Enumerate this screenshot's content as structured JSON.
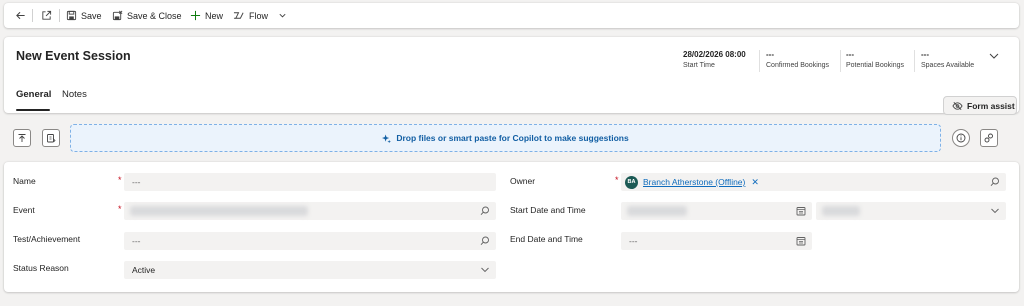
{
  "toolbar": {
    "save_label": "Save",
    "save_close_label": "Save & Close",
    "new_label": "New",
    "flow_label": "Flow"
  },
  "header": {
    "title": "New Event Session",
    "kpis": [
      {
        "value": "28/02/2026 08:00",
        "label": "Start Time"
      },
      {
        "value": "---",
        "label": "Confirmed Bookings"
      },
      {
        "value": "---",
        "label": "Potential Bookings"
      },
      {
        "value": "---",
        "label": "Spaces Available"
      }
    ],
    "tabs": [
      "General",
      "Notes"
    ]
  },
  "form_assist_label": "Form assist",
  "copilot": {
    "dropzone_text": "Drop files or smart paste for Copilot to make suggestions"
  },
  "fields": {
    "name": {
      "label": "Name",
      "value": "---"
    },
    "event": {
      "label": "Event",
      "value": ""
    },
    "test_achievement": {
      "label": "Test/Achievement",
      "value": "---"
    },
    "status_reason": {
      "label": "Status Reason",
      "value": "Active"
    },
    "owner": {
      "label": "Owner",
      "value": "Branch Atherstone (Offline)",
      "avatar_initials": "BA"
    },
    "start_date_time": {
      "label": "Start Date and Time"
    },
    "end_date_time": {
      "label": "End Date and Time",
      "value": "---"
    }
  },
  "colors": {
    "accent": "#0f6cbd",
    "required": "#c50f1f",
    "avatar": "#1c5a55"
  }
}
